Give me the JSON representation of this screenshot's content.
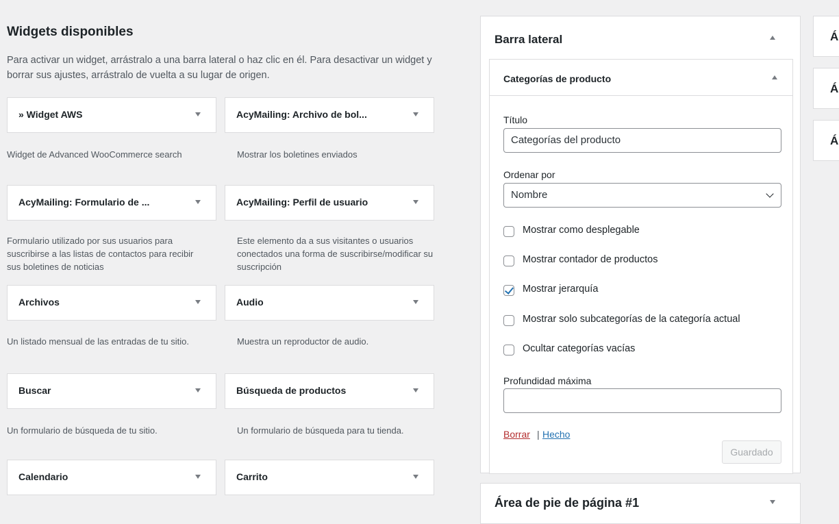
{
  "available": {
    "heading": "Widgets disponibles",
    "description": "Para activar un widget, arrástralo a una barra lateral o haz clic en él. Para desactivar un widget y borrar sus ajustes, arrástralo de vuelta a su lugar de origen.",
    "widgets": [
      {
        "title": "» Widget AWS",
        "desc": "Widget de Advanced WooCommerce search"
      },
      {
        "title": "AcyMailing: Archivo de bol...",
        "desc": "Mostrar los boletines enviados"
      },
      {
        "title": "AcyMailing: Formulario de ...",
        "desc": "Formulario utilizado por sus usuarios para suscribirse a las listas de contactos para recibir sus boletines de noticias"
      },
      {
        "title": "AcyMailing: Perfil de usuario",
        "desc": "Este elemento da a sus visitantes o usuarios conectados una forma de suscribirse/modificar su suscripción"
      },
      {
        "title": "Archivos",
        "desc": "Un listado mensual de las entradas de tu sitio."
      },
      {
        "title": "Audio",
        "desc": "Muestra un reproductor de audio."
      },
      {
        "title": "Buscar",
        "desc": "Un formulario de búsqueda de tu sitio."
      },
      {
        "title": "Búsqueda de productos",
        "desc": "Un formulario de búsqueda para tu tienda."
      },
      {
        "title": "Calendario",
        "desc": ""
      },
      {
        "title": "Carrito",
        "desc": ""
      }
    ]
  },
  "sidebar": {
    "title": "Barra lateral",
    "widget": {
      "title": "Categorías de producto",
      "fields": {
        "titulo_label": "Título",
        "titulo_value": "Categorías del producto",
        "orden_label": "Ordenar por",
        "orden_value": "Nombre",
        "profundidad_label": "Profundidad máxima",
        "profundidad_value": ""
      },
      "checkboxes": [
        {
          "label": "Mostrar como desplegable",
          "checked": false
        },
        {
          "label": "Mostrar contador de productos",
          "checked": false
        },
        {
          "label": "Mostrar jerarquía",
          "checked": true
        },
        {
          "label": "Mostrar solo subcategorías de la categoría actual",
          "checked": false
        },
        {
          "label": "Ocultar categorías vacías",
          "checked": false
        }
      ],
      "delete_link": "Borrar",
      "separator": "|",
      "done_link": "Hecho",
      "save_button": "Guardado"
    }
  },
  "footer_area": {
    "title": "Área de pie de página #1"
  },
  "right_areas": [
    "Ár",
    "Ár",
    "Ár"
  ],
  "colors": {
    "link": "#2271b1",
    "delete": "#b32d2e",
    "check": "#2271b1"
  }
}
